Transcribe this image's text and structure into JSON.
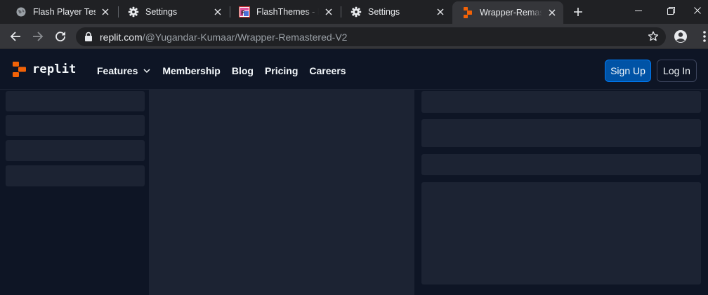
{
  "browser": {
    "tabs": [
      {
        "title": "Flash Player Test",
        "favicon": "globe-icon",
        "active": false
      },
      {
        "title": "Settings",
        "favicon": "gear-icon",
        "active": false
      },
      {
        "title": "FlashThemes - M",
        "favicon": "flashthemes-logo-icon",
        "active": false
      },
      {
        "title": "Settings",
        "favicon": "gear-icon",
        "active": false
      },
      {
        "title": "Wrapper-Remaste",
        "favicon": "replit-logo-icon",
        "active": true
      }
    ],
    "address": {
      "host": "replit.com",
      "path": "/@Yugandar-Kumaar/Wrapper-Remastered-V2"
    }
  },
  "site": {
    "logo_text": "replit",
    "nav": [
      {
        "label": "Features",
        "has_dropdown": true
      },
      {
        "label": "Membership"
      },
      {
        "label": "Blog"
      },
      {
        "label": "Pricing"
      },
      {
        "label": "Careers"
      }
    ],
    "signup_label": "Sign Up",
    "login_label": "Log In"
  },
  "colors": {
    "page_bg": "#0e1525",
    "skeleton": "#1c2333",
    "replit_orange": "#f26207",
    "signup_bg": "#0053a6"
  }
}
